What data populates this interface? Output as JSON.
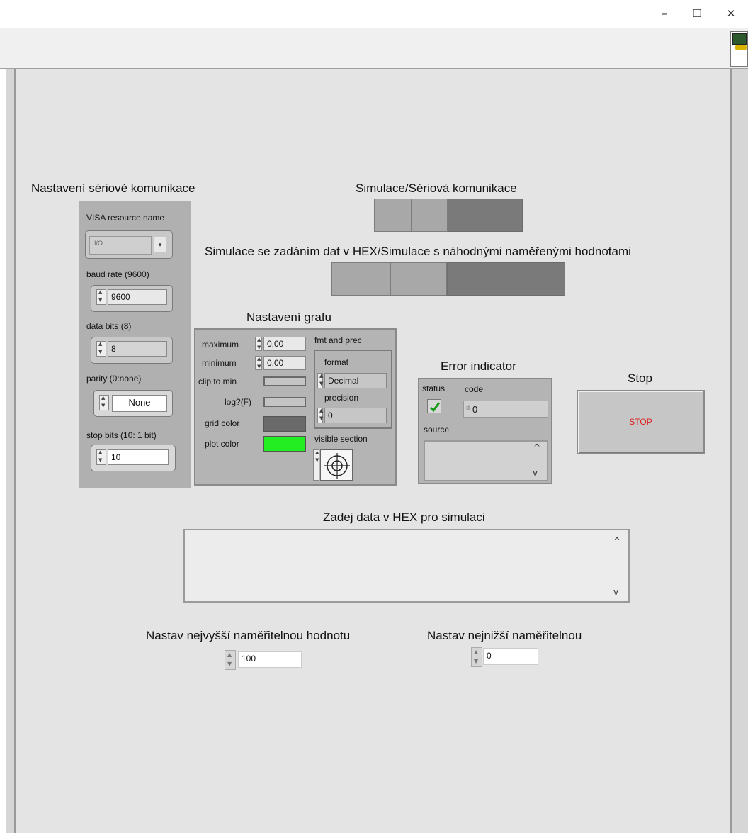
{
  "window": {
    "minimize": "–",
    "maximize": "☐",
    "close": "✕"
  },
  "serial": {
    "title": "Nastavení sériové komunikace",
    "visa_label": "VISA resource name",
    "visa_value": "",
    "visa_io_glyph": "I/O",
    "baud_label": "baud rate (9600)",
    "baud_value": "9600",
    "databits_label": "data bits (8)",
    "databits_value": "8",
    "parity_label": "parity (0:none)",
    "parity_value": "None",
    "stopbits_label": "stop bits (10: 1 bit)",
    "stopbits_value": "10"
  },
  "switch1": {
    "label": "Simulace/Sériová komunikace"
  },
  "switch2": {
    "label": "Simulace se zadáním dat v HEX/Simulace s náhodnými naměřenými hodnotami"
  },
  "graph": {
    "title": "Nastavení grafu",
    "maximum_label": "maximum",
    "maximum_value": "0,00",
    "minimum_label": "minimum",
    "minimum_value": "0,00",
    "clip_label": "clip to min",
    "log_label": "log?(F)",
    "grid_label": "grid color",
    "plot_label": "plot color",
    "grid_color": "#6a6a6a",
    "plot_color": "#22ee22",
    "fmt_label": "fmt and prec",
    "format_label": "format",
    "format_value": "Decimal",
    "precision_label": "precision",
    "precision_value": "0",
    "visible_label": "visible section"
  },
  "error": {
    "title": "Error indicator",
    "status_label": "status",
    "code_label": "code",
    "code_value": "0",
    "code_glyph": "d",
    "source_label": "source",
    "source_value": "",
    "status_icon": "check-icon"
  },
  "stop": {
    "label": "Stop",
    "button_text": "STOP"
  },
  "hex": {
    "label": "Zadej data v HEX pro simulaci",
    "value": ""
  },
  "max_value": {
    "label": "Nastav nejvyšší naměřitelnou hodnotu",
    "value": "100"
  },
  "min_value": {
    "label": "Nastav nejnižší naměřitelnou",
    "value": "0"
  }
}
